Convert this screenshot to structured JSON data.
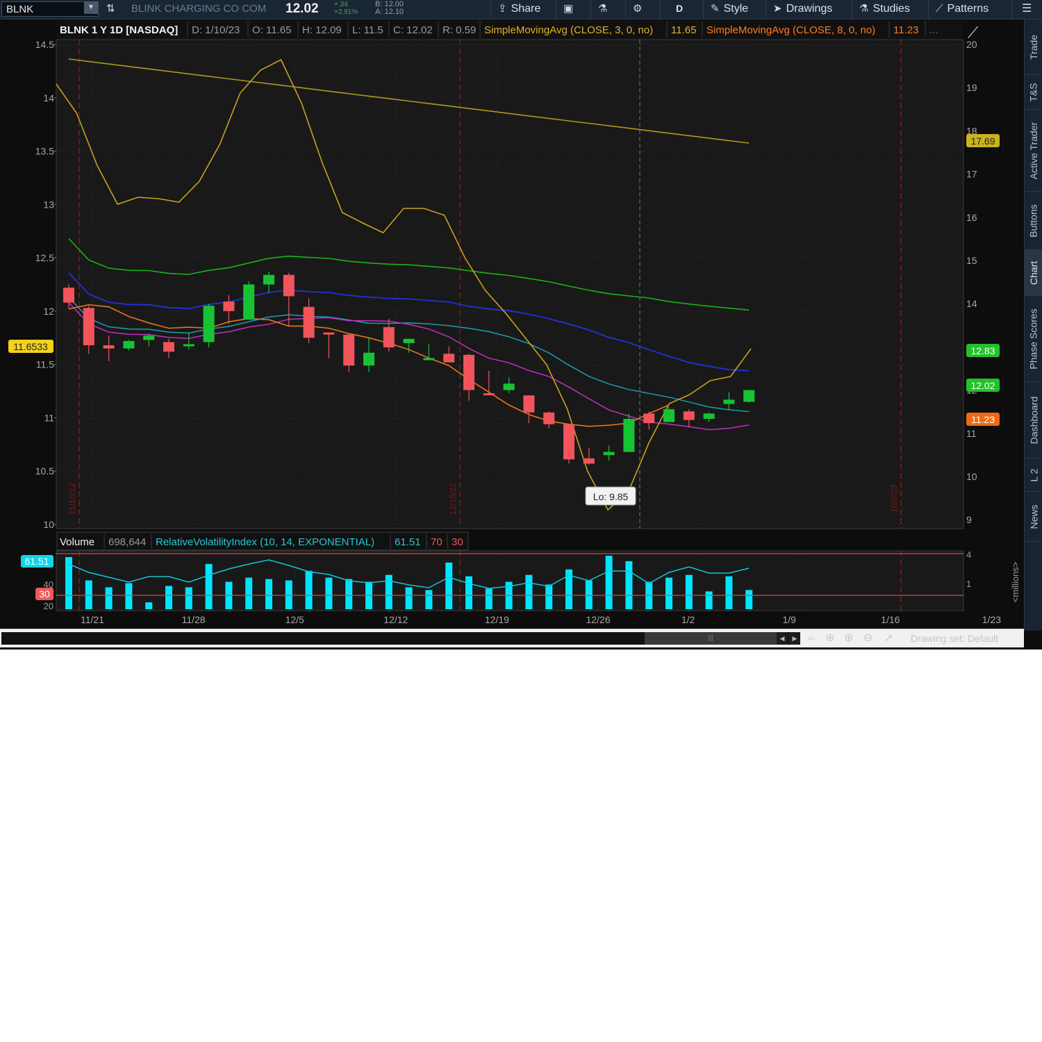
{
  "toolbar": {
    "symbol": "BLNK",
    "company": "BLINK CHARGING CO COM",
    "last_price": "12.02",
    "net_change": "+.34",
    "pct_change": "+2.91%",
    "bid": "B: 12.00",
    "ask": "A: 12.10",
    "share_label": "Share",
    "aggregation": "D",
    "style_label": "Style",
    "drawings_label": "Drawings",
    "studies_label": "Studies",
    "patterns_label": "Patterns"
  },
  "header": {
    "title": "BLNK 1 Y 1D [NASDAQ]",
    "fields": [
      "D: 1/10/23",
      "O: 11.65",
      "H: 12.09",
      "L: 11.5",
      "C: 12.02",
      "R: 0.59"
    ],
    "sma3_label": "SimpleMovingAvg (CLOSE, 3, 0, no)",
    "sma3_value": "11.65",
    "sma8_label": "SimpleMovingAvg (CLOSE, 8, 0, no)",
    "sma8_value": "11.23",
    "more": "..."
  },
  "volume_header": {
    "label": "Volume",
    "value": "698,644",
    "rvi_label": "RelativeVolatilityIndex (10, 14, EXPONENTIAL)",
    "rvi_value": "61.51",
    "upper": "70",
    "lower": "30"
  },
  "side_tabs": [
    "Trade",
    "T&S",
    "Active Trader",
    "Buttons",
    "Chart",
    "Phase Scores",
    "Dashboard",
    "L 2",
    "News"
  ],
  "bottom": {
    "drawing_set": "Drawing set: Default"
  },
  "colors": {
    "up": "#17c335",
    "down": "#f1545b",
    "sma3": "#c9a21e",
    "sma8": "#e8751a",
    "sma_magenta": "#c22fc2",
    "sma_teal": "#1b9fb0",
    "sma_blue": "#2431d8",
    "sma_green": "#1ab21a",
    "sma_long": "#a99b1c",
    "volume": "#00e5ff"
  },
  "chart_data": {
    "type": "candlestick",
    "ylim": [
      10,
      14.5
    ],
    "yticks_left": [
      "14.5",
      "14",
      "13.5",
      "13",
      "12.5",
      "12",
      "11.5",
      "11",
      "10.5",
      "10"
    ],
    "yticks_right": [
      "20",
      "19",
      "18",
      "17",
      "16",
      "15",
      "14",
      "13",
      "12",
      "11",
      "10",
      "9"
    ],
    "x_labels": [
      "11/21",
      "11/28",
      "12/5",
      "12/12",
      "12/19",
      "12/26",
      "1/2",
      "1/9",
      "1/16",
      "1/23"
    ],
    "date_markers": [
      "11/18/22",
      "12/16/22",
      "1/20/23"
    ],
    "candles": [
      {
        "o": 12.22,
        "h": 12.25,
        "l": 12.02,
        "c": 12.08
      },
      {
        "o": 12.03,
        "h": 12.05,
        "l": 11.6,
        "c": 11.68
      },
      {
        "o": 11.68,
        "h": 11.77,
        "l": 11.53,
        "c": 11.65
      },
      {
        "o": 11.65,
        "h": 11.73,
        "l": 11.63,
        "c": 11.72
      },
      {
        "o": 11.73,
        "h": 11.79,
        "l": 11.67,
        "c": 11.77
      },
      {
        "o": 11.71,
        "h": 11.74,
        "l": 11.56,
        "c": 11.62
      },
      {
        "o": 11.68,
        "h": 11.8,
        "l": 11.64,
        "c": 11.69
      },
      {
        "o": 11.71,
        "h": 12.07,
        "l": 11.66,
        "c": 12.05
      },
      {
        "o": 12.09,
        "h": 12.15,
        "l": 11.88,
        "c": 12.0
      },
      {
        "o": 11.92,
        "h": 12.28,
        "l": 11.92,
        "c": 12.25
      },
      {
        "o": 12.25,
        "h": 12.37,
        "l": 12.17,
        "c": 12.34
      },
      {
        "o": 12.34,
        "h": 12.36,
        "l": 11.86,
        "c": 12.14
      },
      {
        "o": 12.04,
        "h": 12.12,
        "l": 11.7,
        "c": 11.75
      },
      {
        "o": 11.8,
        "h": 11.8,
        "l": 11.56,
        "c": 11.78
      },
      {
        "o": 11.78,
        "h": 11.79,
        "l": 11.43,
        "c": 11.49
      },
      {
        "o": 11.49,
        "h": 11.75,
        "l": 11.43,
        "c": 11.61
      },
      {
        "o": 11.85,
        "h": 11.93,
        "l": 11.62,
        "c": 11.66
      },
      {
        "o": 11.7,
        "h": 11.74,
        "l": 11.61,
        "c": 11.74
      },
      {
        "o": 11.55,
        "h": 11.69,
        "l": 11.56,
        "c": 11.56
      },
      {
        "o": 11.6,
        "h": 11.67,
        "l": 11.52,
        "c": 11.52
      },
      {
        "o": 11.59,
        "h": 11.6,
        "l": 11.16,
        "c": 11.26
      },
      {
        "o": 11.23,
        "h": 11.44,
        "l": 11.22,
        "c": 11.22
      },
      {
        "o": 11.26,
        "h": 11.38,
        "l": 11.23,
        "c": 11.32
      },
      {
        "o": 11.21,
        "h": 11.21,
        "l": 10.95,
        "c": 11.05
      },
      {
        "o": 11.05,
        "h": 11.06,
        "l": 10.9,
        "c": 10.94
      },
      {
        "o": 10.94,
        "h": 10.94,
        "l": 10.57,
        "c": 10.61
      },
      {
        "o": 10.62,
        "h": 10.72,
        "l": 10.56,
        "c": 10.57
      },
      {
        "o": 10.65,
        "h": 10.74,
        "l": 10.6,
        "c": 10.68
      },
      {
        "o": 10.68,
        "h": 11.04,
        "l": 10.68,
        "c": 10.99
      },
      {
        "o": 11.04,
        "h": 11.06,
        "l": 10.89,
        "c": 10.95
      },
      {
        "o": 10.96,
        "h": 11.1,
        "l": 10.96,
        "c": 11.08
      },
      {
        "o": 11.06,
        "h": 11.08,
        "l": 10.91,
        "c": 10.98
      },
      {
        "o": 10.99,
        "h": 11.05,
        "l": 10.96,
        "c": 11.04
      },
      {
        "o": 11.13,
        "h": 11.24,
        "l": 11.07,
        "c": 11.17
      },
      {
        "o": 11.15,
        "h": 11.26,
        "l": 11.14,
        "c": 11.26
      }
    ],
    "sma3": [
      13.9,
      13.6,
      13.5,
      13.59,
      13.51,
      13.71,
      14.18,
      14.4,
      13.82,
      13.7,
      13.63,
      13.54,
      13.58,
      13.33,
      13.05,
      12.83,
      12.69,
      12.52,
      12.23,
      11.76,
      11.29,
      10.96,
      10.87,
      11.23,
      11.38,
      11.49,
      11.54,
      11.58,
      11.7,
      11.78
    ],
    "sma3_x": [
      0,
      1,
      2,
      3,
      4,
      5,
      6,
      7,
      8,
      9,
      10,
      11,
      12,
      13,
      14,
      15,
      16,
      17,
      18,
      19,
      20,
      21,
      22,
      23,
      24,
      25,
      26,
      27,
      28,
      29
    ],
    "sma8": [
      12.02,
      12.06,
      12.04,
      11.95,
      11.89,
      11.84,
      11.85,
      11.84,
      11.9,
      11.93,
      11.92,
      11.86,
      11.86,
      11.84,
      11.79,
      11.75,
      11.7,
      11.64,
      11.56,
      11.49,
      11.36,
      11.24,
      11.12,
      11.03,
      10.97,
      10.94,
      10.92,
      10.93,
      10.95,
      11.04,
      11.12
    ],
    "sma3_level": "17.69",
    "right_badges": [
      "17.69",
      "12.83",
      "12.02",
      "11.23"
    ],
    "left_badge": "11.6533",
    "low_label": "Lo: 9.85",
    "volume_millions": [
      3.8,
      2.1,
      1.6,
      1.9,
      0.5,
      1.7,
      1.6,
      3.3,
      2.0,
      2.3,
      2.2,
      2.1,
      2.8,
      2.3,
      2.2,
      2.0,
      2.5,
      1.6,
      1.4,
      3.4,
      2.4,
      1.5,
      2.0,
      2.5,
      1.8,
      2.9,
      2.1,
      3.9,
      3.5,
      2.0,
      2.3,
      2.5,
      1.3,
      2.4,
      1.4
    ],
    "volume_yticks": [
      "4",
      "1"
    ],
    "rvi": [
      61.51
    ],
    "rvi_yticks": [
      "40",
      "20"
    ],
    "volume_unit_label": "<millions>"
  }
}
